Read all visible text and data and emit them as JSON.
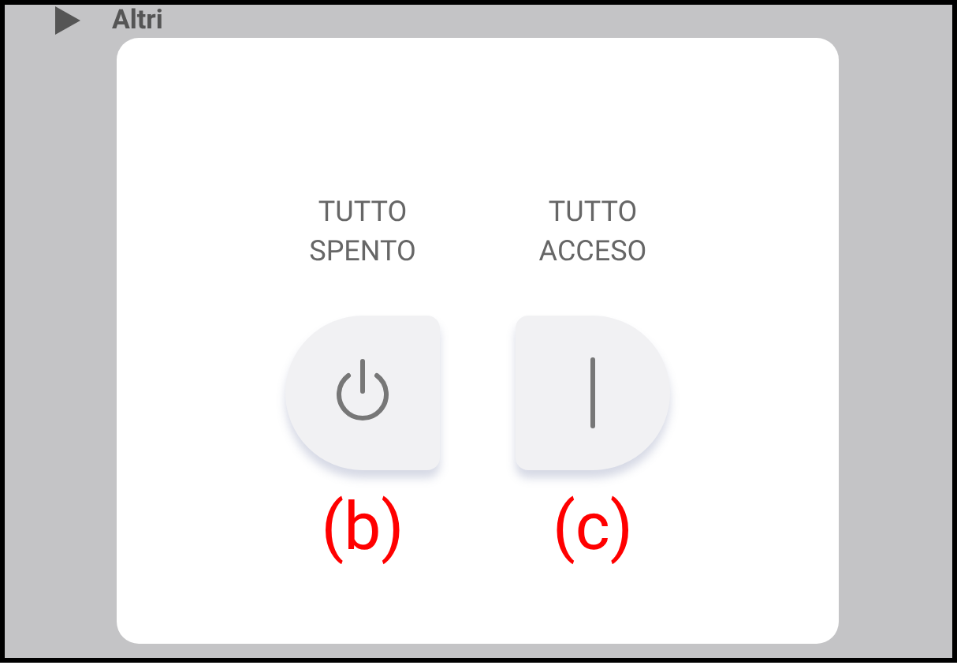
{
  "background": {
    "items": [
      {
        "label": "Altri",
        "expanded": false
      }
    ]
  },
  "dialog": {
    "buttons": [
      {
        "kind": "off",
        "label": "TUTTO SPENTO",
        "annotation": "(b)"
      },
      {
        "kind": "on",
        "label": "TUTTO ACCESO",
        "annotation": "(c)"
      }
    ]
  }
}
